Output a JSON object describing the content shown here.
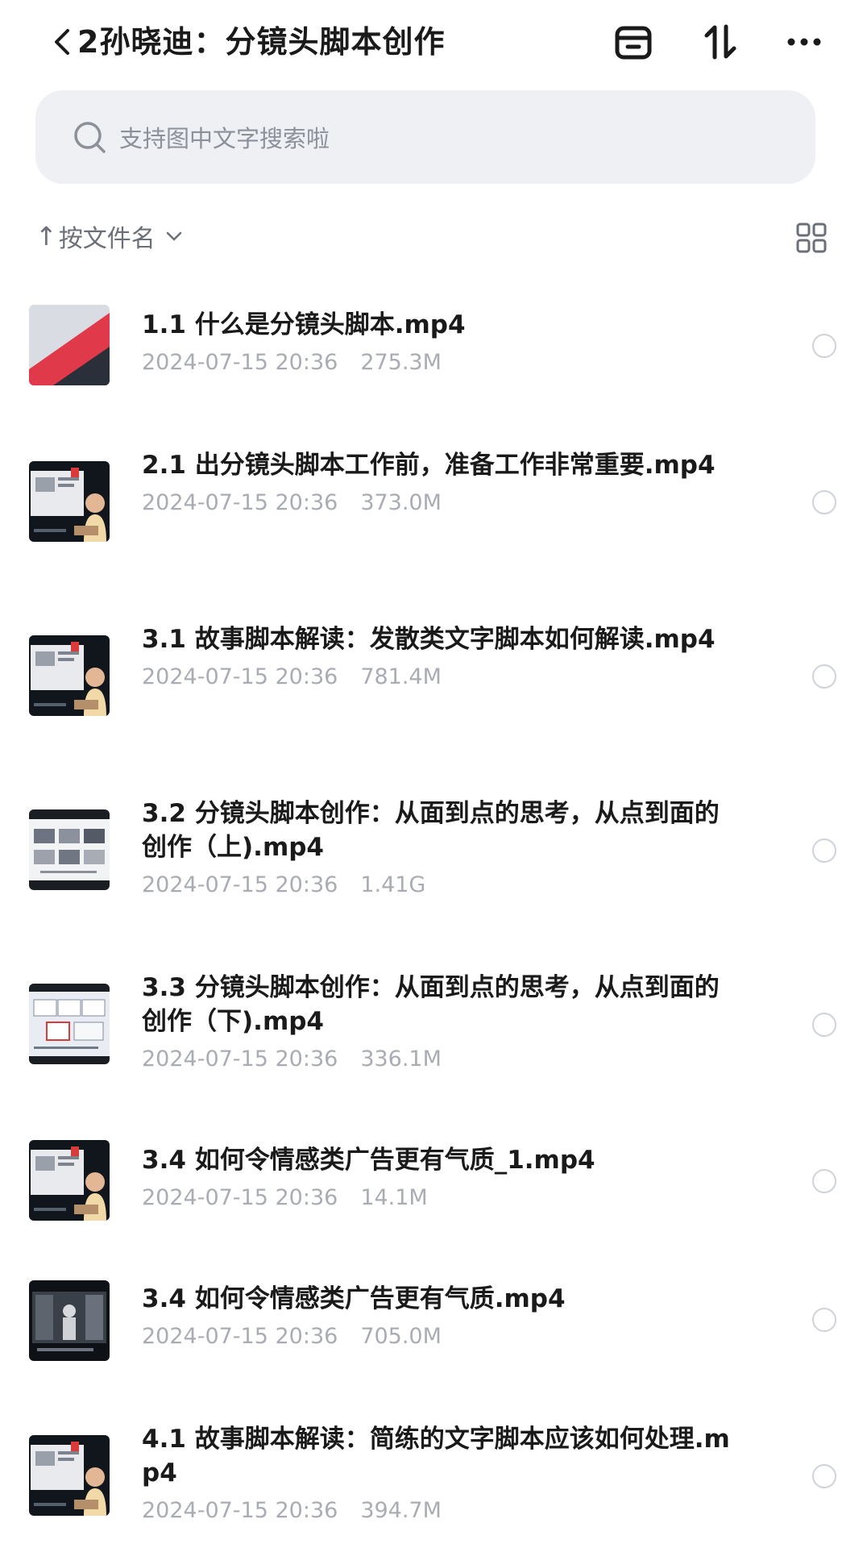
{
  "header": {
    "back_count": "2",
    "title": "孙晓迪：分镜头脚本创作"
  },
  "search": {
    "placeholder": "支持图中文字搜索啦"
  },
  "sort": {
    "arrow": "↑",
    "label": "按文件名"
  },
  "files": [
    {
      "name": "1.1 什么是分镜头脚本.mp4",
      "date": "2024-07-15 20:36",
      "size": "275.3M",
      "thumb": "red-diagonal"
    },
    {
      "name": "2.1 出分镜头脚本工作前，准备工作非常重要.mp4",
      "date": "2024-07-15 20:36",
      "size": "373.0M",
      "thumb": "lecture"
    },
    {
      "name": "3.1 故事脚本解读：发散类文字脚本如何解读.mp4",
      "date": "2024-07-15 20:36",
      "size": "781.4M",
      "thumb": "lecture"
    },
    {
      "name": "3.2 分镜头脚本创作：从面到点的思考，从点到面的创作（上).mp4",
      "date": "2024-07-15 20:36",
      "size": "1.41G",
      "thumb": "storyboard"
    },
    {
      "name": "3.3 分镜头脚本创作：从面到点的思考，从点到面的创作（下).mp4",
      "date": "2024-07-15 20:36",
      "size": "336.1M",
      "thumb": "storyboard-light"
    },
    {
      "name": "3.4 如何令情感类广告更有气质_1.mp4",
      "date": "2024-07-15 20:36",
      "size": "14.1M",
      "thumb": "lecture"
    },
    {
      "name": "3.4 如何令情感类广告更有气质.mp4",
      "date": "2024-07-15 20:36",
      "size": "705.0M",
      "thumb": "dark-scene"
    },
    {
      "name": "4.1 故事脚本解读：简练的文字脚本应该如何处理.mp4",
      "date": "2024-07-15 20:36",
      "size": "394.7M",
      "thumb": "lecture"
    }
  ]
}
